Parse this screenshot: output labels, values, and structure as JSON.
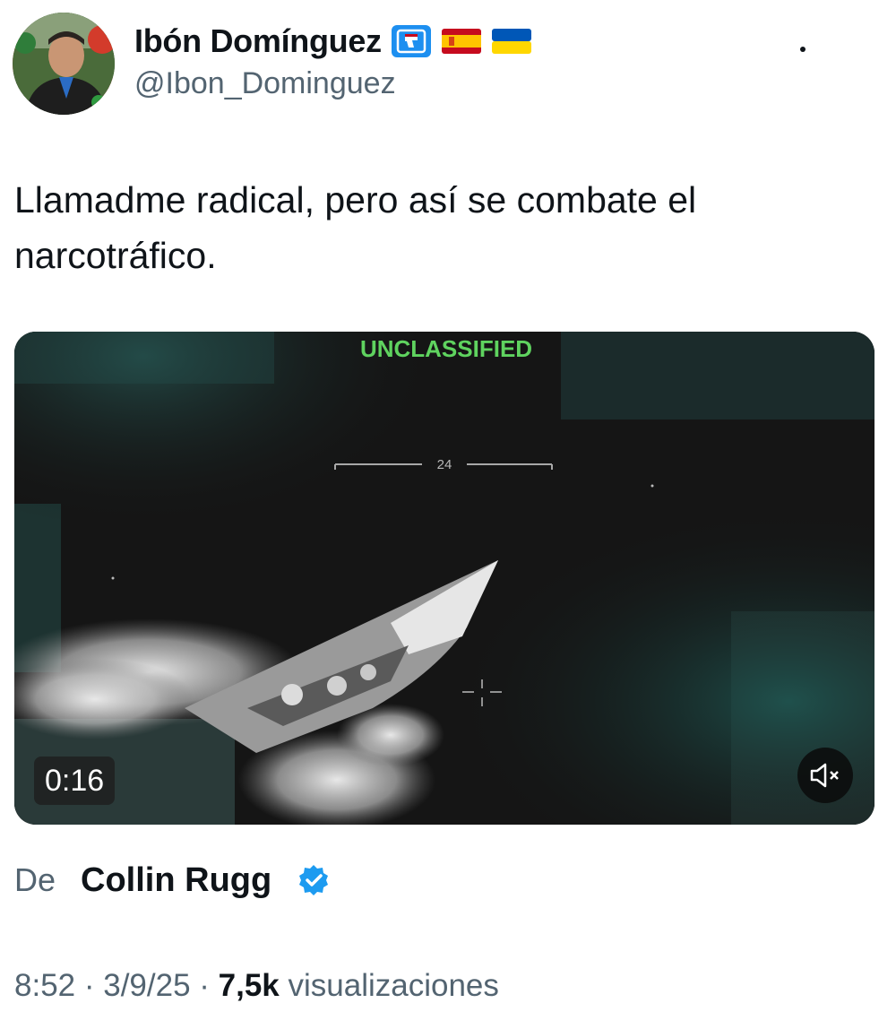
{
  "author": {
    "display_name": "Ibón Domínguez",
    "handle": "@Ibon_Dominguez",
    "badges": [
      "spain-fist-icon",
      "flag-spain-icon",
      "flag-ukraine-icon"
    ]
  },
  "tweet": {
    "text": "Llamadme radical, pero así se combate el narcotráfico."
  },
  "media": {
    "overlay_text": "UNCLASSIFIED",
    "reticle_number": "24",
    "duration": "0:16",
    "mute_icon": "speaker-muted-icon"
  },
  "source": {
    "prefix": "De",
    "name": "Collin Rugg",
    "badge_icon": "verified-badge-icon",
    "badge_color": "#1d9bf0"
  },
  "meta": {
    "time": "8:52",
    "separator": " · ",
    "date": "3/9/25",
    "views_count": "7,5k",
    "views_label": " visualizaciones"
  },
  "colors": {
    "text": "#0f1419",
    "secondary": "#536471",
    "hud_green": "#5fd35f"
  }
}
